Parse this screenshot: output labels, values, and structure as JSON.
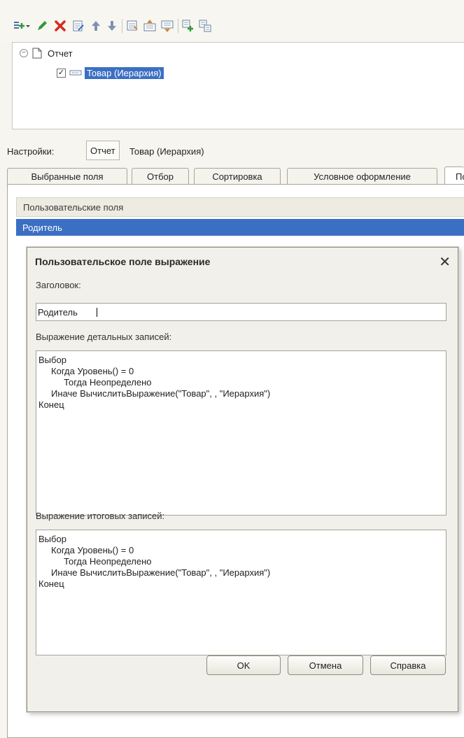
{
  "tree": {
    "root_label": "Отчет",
    "child_label": "Товар (Иерархия)",
    "child_checked": true
  },
  "settings": {
    "label": "Настройки:",
    "button_label": "Отчет",
    "value": "Товар (Иерархия)"
  },
  "tabs": [
    {
      "label": "Выбранные поля"
    },
    {
      "label": "Отбор"
    },
    {
      "label": "Сортировка"
    },
    {
      "label": "Условное оформление"
    },
    {
      "label": "По"
    }
  ],
  "fields": {
    "header": "Пользовательские поля",
    "selected_row": "Родитель"
  },
  "dialog": {
    "title": "Пользовательское поле выражение",
    "caption_label": "Заголовок:",
    "caption_value": "Родитель",
    "detail_label": "Выражение детальных записей:",
    "detail_expression": "Выбор\n     Когда Уровень() = 0\n          Тогда Неопределено\n     Иначе ВычислитьВыражение(\"Товар\", , \"Иерархия\")\nКонец",
    "total_label": "Выражение итоговых записей:",
    "total_expression": "Выбор\n     Когда Уровень() = 0\n          Тогда Неопределено\n     Иначе ВычислитьВыражение(\"Товар\", , \"Иерархия\")\nКонец",
    "ok_label": "OK",
    "cancel_label": "Отмена",
    "help_label": "Справка"
  },
  "colors": {
    "selection": "#3b6fc3",
    "add_icon": "#2f9a3a",
    "delete_icon": "#d52b1e"
  }
}
